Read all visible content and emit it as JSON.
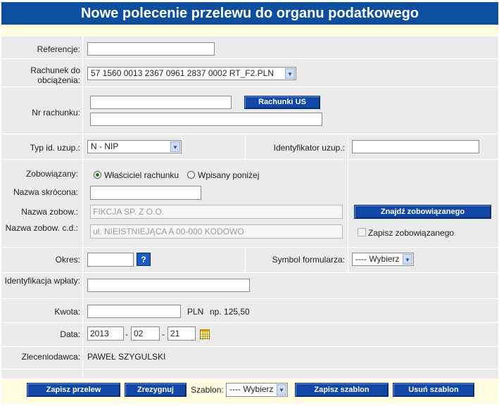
{
  "title": "Nowe polecenie przelewu do organu podatkowego",
  "fields": {
    "referencje_label": "Referencje:",
    "rachunek_label": "Rachunek do obciążenia:",
    "rachunek_value": "57 1560 0013 2367 0961 2837 0002  RT_F2.PLN",
    "nr_rachunku_label": "Nr rachunku:",
    "rachunki_us_button": "Rachunki US",
    "typ_id_label": "Typ id. uzup.:",
    "typ_id_value": "N - NIP",
    "identyfikator_label": "Identyfikator uzup.:",
    "zobowiazany_label": "Zobowiązany:",
    "radio_owner": "Właściciel rachunku",
    "radio_below": "Wpisany poniżej",
    "nazwa_skrocona_label": "Nazwa skrócona:",
    "nazwa_zobow_label": "Nazwa zobow.:",
    "nazwa_zobow_value": "FIKCJA SP. Z O.O.",
    "nazwa_zobow_cd_label": "Nazwa zobow. c.d.:",
    "nazwa_zobow_cd_value": "ul. NIEISTNIEJĄCA A 00-000 KODOWO",
    "znajdz_button": "Znajdź zobowiązanego",
    "zapisz_zobow_label": "Zapisz zobowiązanego",
    "okres_label": "Okres:",
    "help_glyph": "?",
    "symbol_label": "Symbol formularza:",
    "symbol_value": "---- Wybierz",
    "identyfikacja_label": "Identyfikacja wpłaty:",
    "kwota_label": "Kwota:",
    "kwota_currency": "PLN",
    "kwota_hint": "np. 125,50",
    "data_label": "Data:",
    "data_year": "2013",
    "data_month": "02",
    "data_day": "21",
    "date_sep": "-",
    "zleceniodawca_label": "Zleceniodawca:",
    "zleceniodawca_value": "PAWEŁ SZYGULSKI"
  },
  "footer": {
    "zapisz_przelew": "Zapisz przelew",
    "zrezygnuj": "Zrezygnuj",
    "szablon_label": "Szablon:",
    "szablon_value": "---- Wybierz",
    "zapisz_szablon": "Zapisz szablon",
    "usun_szablon": "Usuń szablon"
  },
  "colors": {
    "title_bg": "#0d4f9e",
    "panel_bg": "#ebebeb",
    "cream_bg": "#fffbe0",
    "button_bg": "#1148a8"
  },
  "icons": [
    "help-icon",
    "calendar-icon",
    "dropdown-arrow-icon"
  ]
}
